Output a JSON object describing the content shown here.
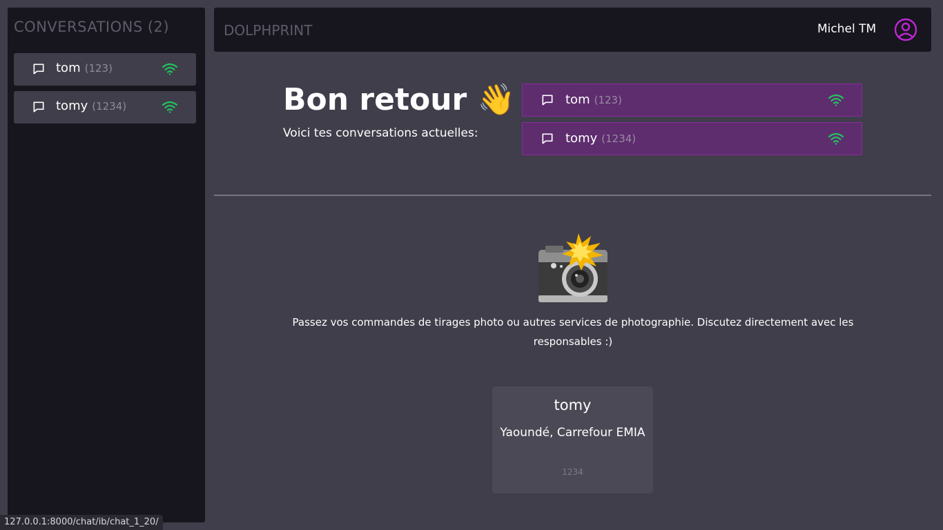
{
  "sidebar": {
    "title": "CONVERSATIONS (2)",
    "items": [
      {
        "name": "tom",
        "code": "(123)",
        "icon": "chat-icon",
        "status_icon": "wifi-icon"
      },
      {
        "name": "tomy",
        "code": "(1234)",
        "icon": "chat-icon",
        "status_icon": "wifi-icon"
      }
    ]
  },
  "header": {
    "brand": "DOLPHPRINT",
    "user_name": "Michel TM",
    "user_icon": "user-circle-icon"
  },
  "welcome": {
    "title": "Bon retour 👋",
    "subtitle": "Voici tes conversations actuelles:",
    "conversations": [
      {
        "name": "tom",
        "code": "(123)"
      },
      {
        "name": "tomy",
        "code": "(1234)"
      }
    ]
  },
  "promo": {
    "icon": "camera-flash-icon",
    "text": "Passez vos commandes de tirages photo ou autres services de photographie. Discutez directement avec les responsables :)"
  },
  "shop_card": {
    "name": "tomy",
    "address": "Yaoundé, Carrefour EMIA",
    "code": "1234"
  },
  "statusbar": {
    "url": "127.0.0.1:8000/chat/ib/chat_1_20/"
  },
  "colors": {
    "page_bg": "#3f3e4a",
    "panel_bg": "#17161f",
    "accent_purple": "#5e2d6e",
    "online_green": "#22c55e",
    "user_icon": "#c026d3"
  }
}
